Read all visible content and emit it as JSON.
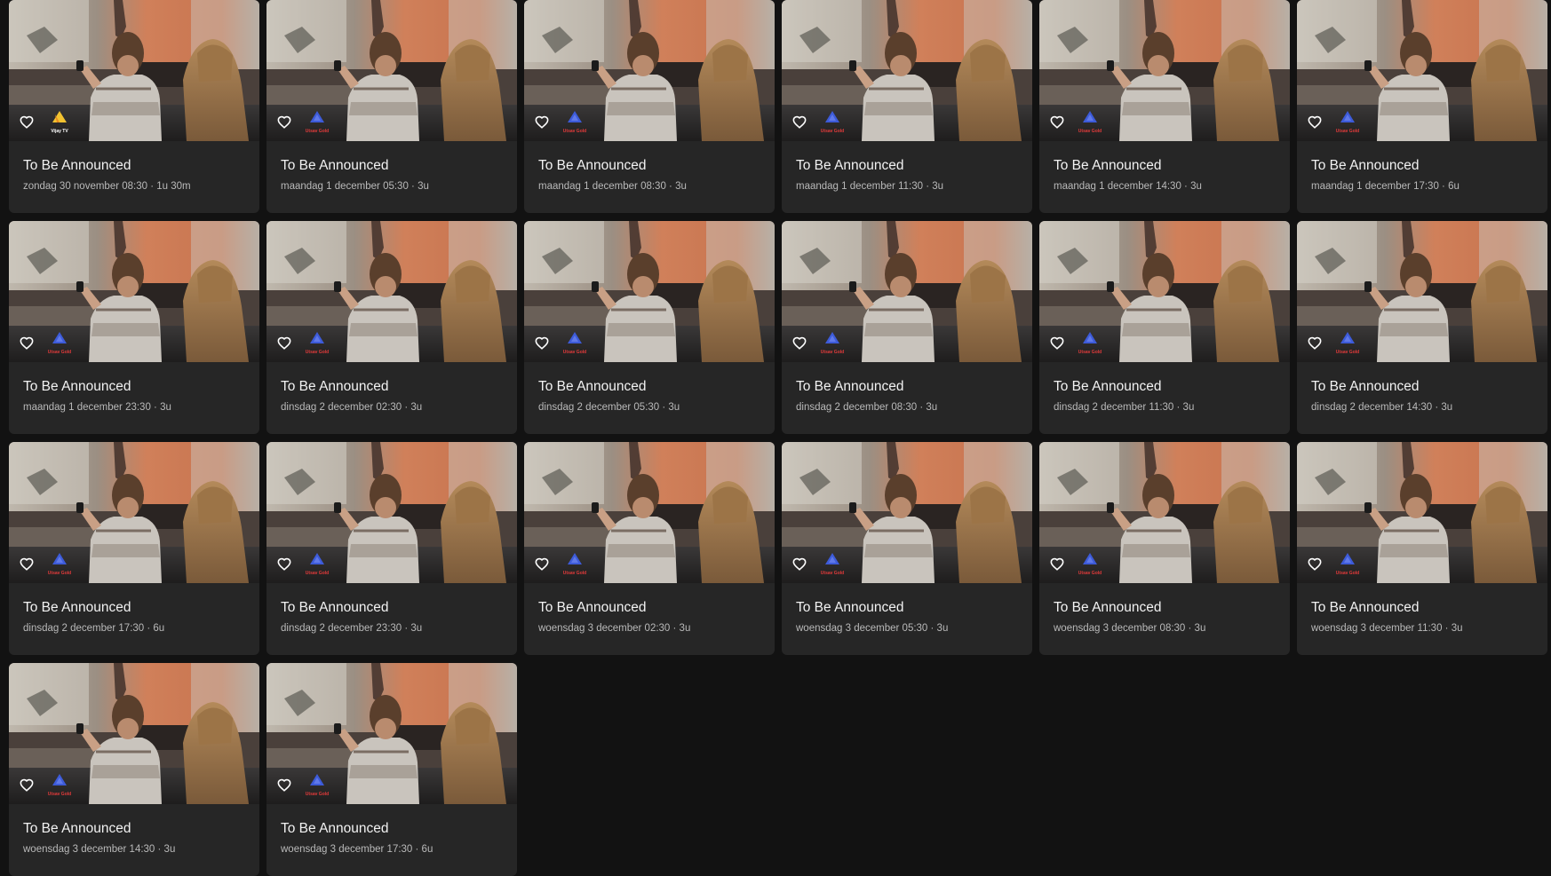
{
  "cards": [
    {
      "title": "To Be Announced",
      "meta": "zondag 30 november 08:30 · 1u 30m",
      "channel": "Vijay TV",
      "channel_style": "vijay"
    },
    {
      "title": "To Be Announced",
      "meta": "maandag 1 december 05:30 · 3u",
      "channel": "Utsav Gold",
      "channel_style": "gold"
    },
    {
      "title": "To Be Announced",
      "meta": "maandag 1 december 08:30 · 3u",
      "channel": "Utsav Gold",
      "channel_style": "gold"
    },
    {
      "title": "To Be Announced",
      "meta": "maandag 1 december 11:30 · 3u",
      "channel": "Utsav Gold",
      "channel_style": "gold"
    },
    {
      "title": "To Be Announced",
      "meta": "maandag 1 december 14:30 · 3u",
      "channel": "Utsav Gold",
      "channel_style": "gold"
    },
    {
      "title": "To Be Announced",
      "meta": "maandag 1 december 17:30 · 6u",
      "channel": "Utsav Gold",
      "channel_style": "gold"
    },
    {
      "title": "To Be Announced",
      "meta": "maandag 1 december 23:30 · 3u",
      "channel": "Utsav Gold",
      "channel_style": "gold"
    },
    {
      "title": "To Be Announced",
      "meta": "dinsdag 2 december 02:30 · 3u",
      "channel": "Utsav Gold",
      "channel_style": "gold"
    },
    {
      "title": "To Be Announced",
      "meta": "dinsdag 2 december 05:30 · 3u",
      "channel": "Utsav Gold",
      "channel_style": "gold"
    },
    {
      "title": "To Be Announced",
      "meta": "dinsdag 2 december 08:30 · 3u",
      "channel": "Utsav Gold",
      "channel_style": "gold"
    },
    {
      "title": "To Be Announced",
      "meta": "dinsdag 2 december 11:30 · 3u",
      "channel": "Utsav Gold",
      "channel_style": "gold"
    },
    {
      "title": "To Be Announced",
      "meta": "dinsdag 2 december 14:30 · 3u",
      "channel": "Utsav Gold",
      "channel_style": "gold"
    },
    {
      "title": "To Be Announced",
      "meta": "dinsdag 2 december 17:30 · 6u",
      "channel": "Utsav Gold",
      "channel_style": "gold"
    },
    {
      "title": "To Be Announced",
      "meta": "dinsdag 2 december 23:30 · 3u",
      "channel": "Utsav Gold",
      "channel_style": "gold"
    },
    {
      "title": "To Be Announced",
      "meta": "woensdag 3 december 02:30 · 3u",
      "channel": "Utsav Gold",
      "channel_style": "gold"
    },
    {
      "title": "To Be Announced",
      "meta": "woensdag 3 december 05:30 · 3u",
      "channel": "Utsav Gold",
      "channel_style": "gold"
    },
    {
      "title": "To Be Announced",
      "meta": "woensdag 3 december 08:30 · 3u",
      "channel": "Utsav Gold",
      "channel_style": "gold"
    },
    {
      "title": "To Be Announced",
      "meta": "woensdag 3 december 11:30 · 3u",
      "channel": "Utsav Gold",
      "channel_style": "gold"
    },
    {
      "title": "To Be Announced",
      "meta": "woensdag 3 december 14:30 · 3u",
      "channel": "Utsav Gold",
      "channel_style": "gold"
    },
    {
      "title": "To Be Announced",
      "meta": "woensdag 3 december 17:30 · 6u",
      "channel": "Utsav Gold",
      "channel_style": "gold"
    }
  ],
  "icons": {
    "favorite": "heart-outline-icon",
    "channel_logo_gold": "utsav-gold-triangle-logo",
    "channel_logo_vijay": "vijay-tv-logo"
  },
  "colors": {
    "page_background": "#121212",
    "card_background": "#262626",
    "title_text": "#f2f2f2",
    "meta_text": "#b9b9b9",
    "gold_logo_triangle": "#3d5bd9",
    "gold_logo_text": "#e23a3a",
    "vijay_logo": "#f2c230"
  }
}
